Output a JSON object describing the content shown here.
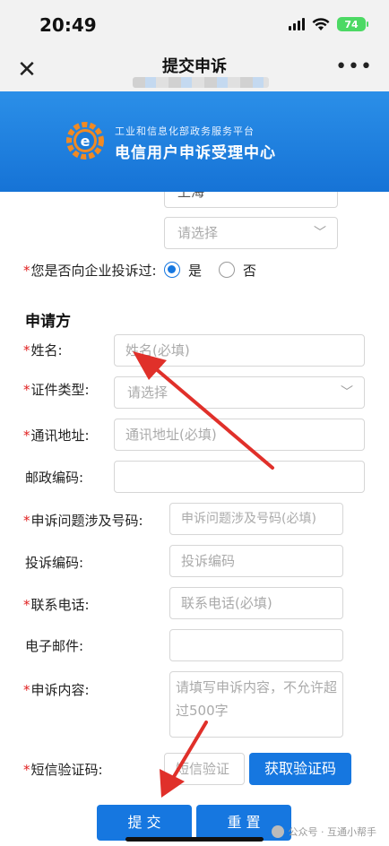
{
  "status_bar": {
    "time": "20:49",
    "battery": "74"
  },
  "nav": {
    "title": "提交申诉",
    "close_icon": "close-icon",
    "more_icon": "more-dots-icon"
  },
  "banner": {
    "subtitle": "工业和信息化部政务服务平台",
    "title": "电信用户申诉受理中心"
  },
  "form": {
    "province_value": "上海",
    "city_placeholder": "请选择",
    "complained_label": "您是否向企业投诉过:",
    "complained_yes": "是",
    "complained_no": "否",
    "complained_selected": "是",
    "section_title": "申请方",
    "fields": {
      "name": {
        "label": "姓名:",
        "placeholder": "姓名(必填)",
        "required": true
      },
      "id_type": {
        "label": "证件类型:",
        "placeholder": "请选择",
        "required": true
      },
      "address": {
        "label": "通讯地址:",
        "placeholder": "通讯地址(必填)",
        "required": true
      },
      "postcode": {
        "label": "邮政编码:",
        "placeholder": "",
        "required": false
      },
      "phone_involved": {
        "label": "申诉问题涉及号码:",
        "placeholder": "申诉问题涉及号码(必填)",
        "required": true
      },
      "complaint_code": {
        "label": "投诉编码:",
        "placeholder": "投诉编码",
        "required": false
      },
      "contact_phone": {
        "label": "联系电话:",
        "placeholder": "联系电话(必填)",
        "required": true
      },
      "email": {
        "label": "电子邮件:",
        "placeholder": "",
        "required": false
      },
      "content": {
        "label": "申诉内容:",
        "placeholder": "请填写申诉内容，不允许超过500字",
        "required": true
      },
      "sms_code": {
        "label": "短信验证码:",
        "placeholder": "短信验证",
        "required": true
      }
    },
    "get_code_button": "获取验证码",
    "submit_button": "提 交",
    "reset_button": "重 置",
    "required_mark": "*"
  },
  "watermark": "公众号 · 互通小帮手",
  "colors": {
    "accent": "#1677e0",
    "required": "#e02020",
    "arrow": "#e0302a"
  }
}
